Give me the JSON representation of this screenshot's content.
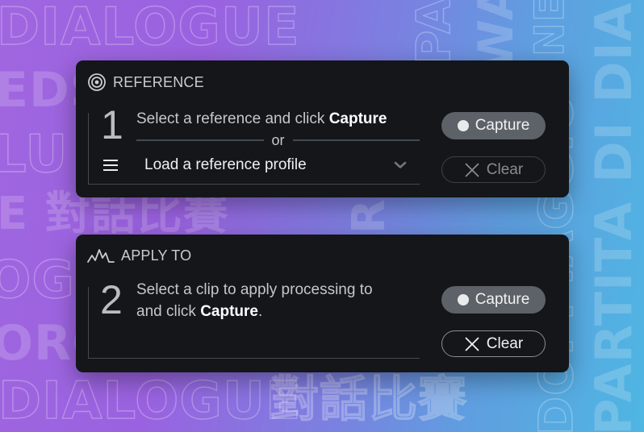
{
  "background": {
    "words": {
      "dialogue": "DIALOGUE",
      "eds": "EDS",
      "lu": "LU",
      "cjk": "E 對話比賽",
      "ogu": "OGU",
      "oro": "ORO",
      "cjk2": "對話比賽",
      "partita": "PARTITA DI DIALOGO",
      "dopp": "DOPPIAGGIO",
      "wa": "WA",
      "pa": "PA",
      "ne": "NE",
      "r": "R"
    }
  },
  "reference_panel": {
    "icon": "target-icon",
    "title": "REFERENCE",
    "step_number": "1",
    "instruction_prefix": "Select a reference and click ",
    "instruction_bold": "Capture",
    "separator": "or",
    "load_icon": "menu-icon",
    "load_label": "Load a reference profile",
    "dropdown_icon": "chevron-down-icon",
    "capture_button": "Capture",
    "clear_button": "Clear",
    "clear_enabled": false
  },
  "apply_panel": {
    "icon": "waveform-icon",
    "title": "APPLY TO",
    "step_number": "2",
    "instruction_line1": "Select a clip to apply processing to",
    "instruction_line2_prefix": "and click ",
    "instruction_bold": "Capture",
    "instruction_suffix": ".",
    "capture_button": "Capture",
    "clear_button": "Clear",
    "clear_enabled": true
  },
  "colors": {
    "panel_bg": "#141619",
    "capture_bg": "#5d6268",
    "bg_gradient_start": "#a066e0",
    "bg_gradient_end": "#4fb6e2"
  }
}
